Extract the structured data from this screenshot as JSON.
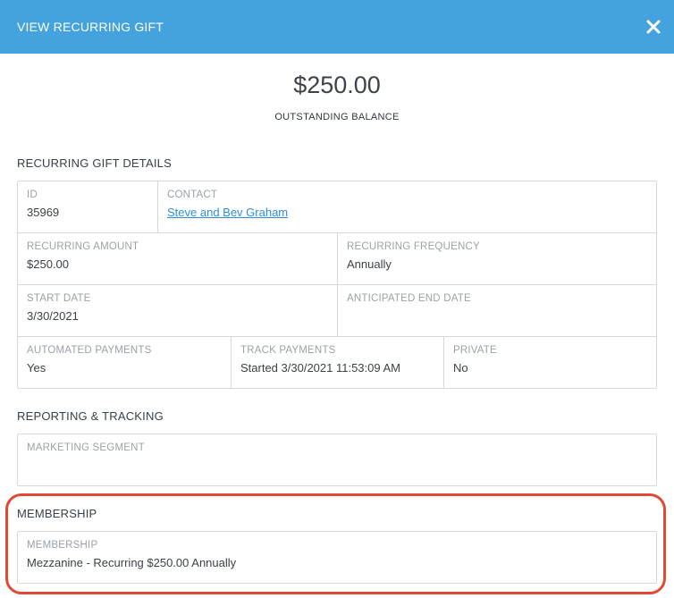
{
  "header": {
    "title": "VIEW RECURRING GIFT",
    "close_icon": "close-icon"
  },
  "summary": {
    "amount": "$250.00",
    "label": "OUTSTANDING BALANCE"
  },
  "details": {
    "title": "RECURRING GIFT DETAILS",
    "id": {
      "label": "ID",
      "value": "35969"
    },
    "contact": {
      "label": "CONTACT",
      "value": "Steve and Bev Graham"
    },
    "recurring_amount": {
      "label": "RECURRING AMOUNT",
      "value": "$250.00"
    },
    "recurring_frequency": {
      "label": "RECURRING FREQUENCY",
      "value": "Annually"
    },
    "start_date": {
      "label": "START DATE",
      "value": "3/30/2021"
    },
    "anticipated_end_date": {
      "label": "ANTICIPATED END DATE",
      "value": ""
    },
    "automated_payments": {
      "label": "AUTOMATED PAYMENTS",
      "value": "Yes"
    },
    "track_payments": {
      "label": "TRACK PAYMENTS",
      "value": "Started 3/30/2021 11:53:09 AM"
    },
    "private": {
      "label": "PRIVATE",
      "value": "No"
    }
  },
  "reporting": {
    "title": "REPORTING & TRACKING",
    "marketing_segment": {
      "label": "MARKETING SEGMENT",
      "value": ""
    }
  },
  "membership": {
    "title": "MEMBERSHIP",
    "field": {
      "label": "MEMBERSHIP",
      "value": "Mezzanine - Recurring $250.00 Annually"
    }
  },
  "colors": {
    "header_bg": "#44a3de",
    "link": "#2c8fd6",
    "highlight": "#e04a34"
  }
}
